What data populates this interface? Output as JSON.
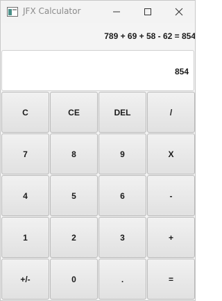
{
  "window": {
    "title": "JFX Calculator",
    "controls": [
      "minimize-icon",
      "maximize-icon",
      "close-icon"
    ]
  },
  "expression": "789 + 69 + 58 - 62 = 854",
  "result": "854",
  "keys": [
    [
      "C",
      "CE",
      "DEL",
      "/"
    ],
    [
      "7",
      "8",
      "9",
      "X"
    ],
    [
      "4",
      "5",
      "6",
      "-"
    ],
    [
      "1",
      "2",
      "3",
      "+"
    ],
    [
      "+/-",
      "0",
      ".",
      "="
    ]
  ],
  "colors": {
    "key_background": "#e6e6e6",
    "display_background": "#ffffff",
    "text": "#1a1a1a",
    "title_text": "#8a8a8a"
  }
}
